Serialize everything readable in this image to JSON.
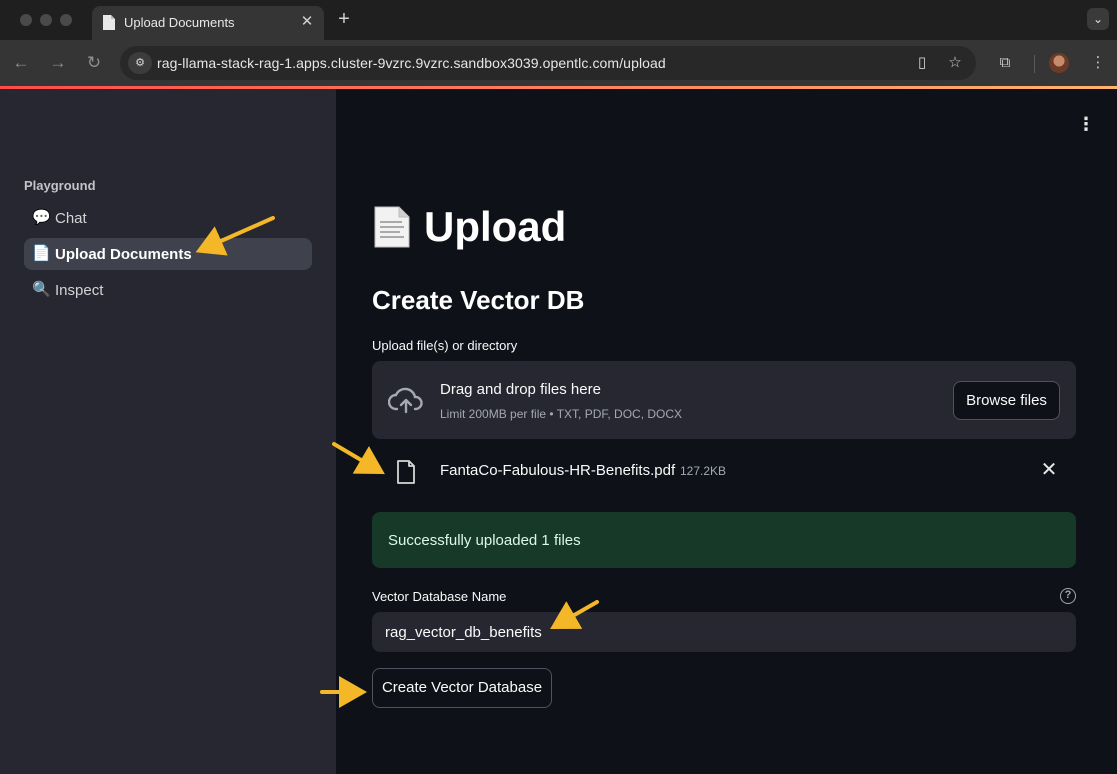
{
  "browser": {
    "tab_title": "Upload Documents",
    "url": "rag-llama-stack-rag-1.apps.cluster-9vzrc.9vzrc.sandbox3039.opentlc.com/upload"
  },
  "sidebar": {
    "section_title": "Playground",
    "items": [
      {
        "label": "Chat",
        "icon": "speech-bubble-icon",
        "emoji": "💬",
        "active": false
      },
      {
        "label": "Upload Documents",
        "icon": "page-icon",
        "emoji": "📄",
        "active": true
      },
      {
        "label": "Inspect",
        "icon": "magnifier-icon",
        "emoji": "🔍",
        "active": false
      }
    ]
  },
  "main": {
    "title": "Upload",
    "title_icon": "page-icon",
    "subtitle": "Create Vector DB",
    "upload_label": "Upload file(s) or directory",
    "dropzone": {
      "title": "Drag and drop files here",
      "subtitle": "Limit 200MB per file • TXT, PDF, DOC, DOCX",
      "browse_label": "Browse files"
    },
    "uploaded_file": {
      "name": "FantaCo-Fabulous-HR-Benefits.pdf",
      "size": "127.2KB"
    },
    "success_message": "Successfully uploaded 1 files",
    "vector_db_label": "Vector Database Name",
    "vector_db_value": "rag_vector_db_benefits",
    "create_button_label": "Create Vector Database"
  },
  "colors": {
    "sidebar_bg": "#262730",
    "main_bg": "#0e1117",
    "success_bg": "#173928",
    "arrow": "#f3b728"
  }
}
